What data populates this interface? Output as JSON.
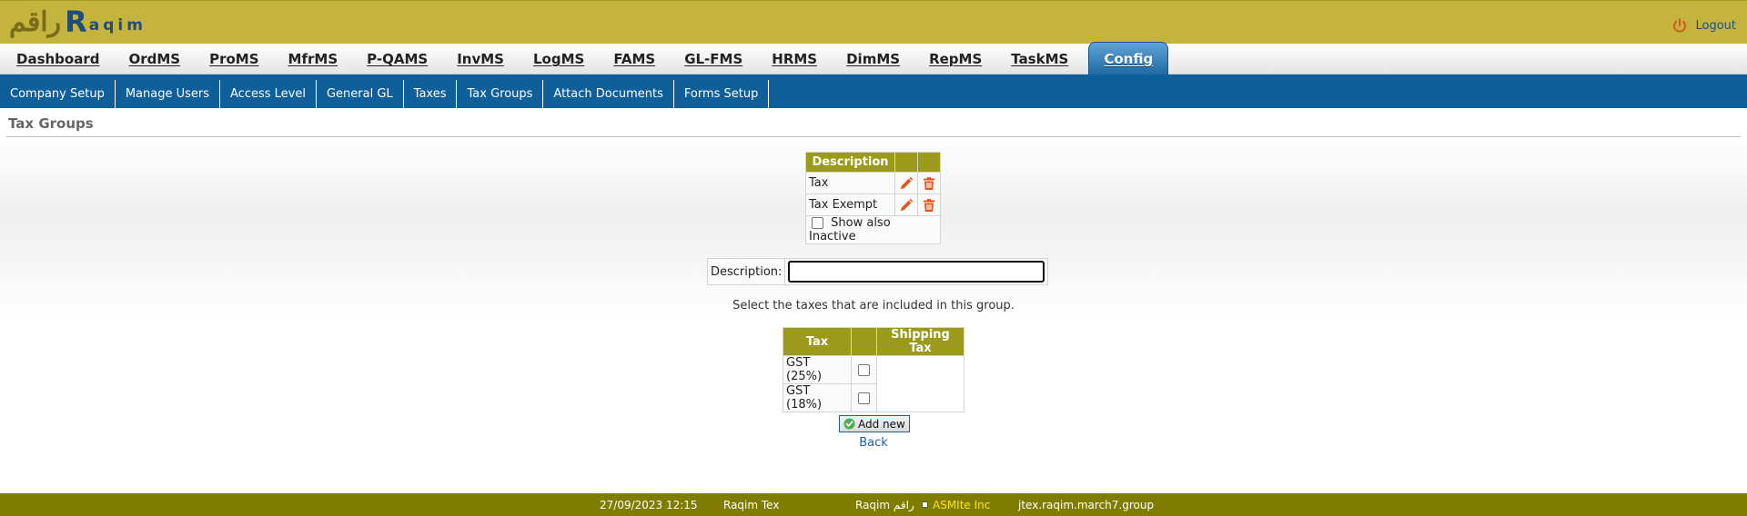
{
  "header": {
    "logo_arabic": "راقم",
    "logo_mark": "R",
    "logo_text": "aqim",
    "logout_label": "Logout"
  },
  "main_nav": {
    "items": [
      {
        "label": "Dashboard"
      },
      {
        "label": "OrdMS"
      },
      {
        "label": "ProMS"
      },
      {
        "label": "MfrMS"
      },
      {
        "label": "P-QAMS"
      },
      {
        "label": "InvMS"
      },
      {
        "label": "LogMS"
      },
      {
        "label": "FAMS"
      },
      {
        "label": "GL-FMS"
      },
      {
        "label": "HRMS"
      },
      {
        "label": "DimMS"
      },
      {
        "label": "RepMS"
      },
      {
        "label": "TaskMS"
      },
      {
        "label": "Config",
        "active": true
      }
    ]
  },
  "sub_nav": {
    "items": [
      {
        "label": "Company Setup"
      },
      {
        "label": "Manage Users"
      },
      {
        "label": "Access Level"
      },
      {
        "label": "General GL"
      },
      {
        "label": "Taxes"
      },
      {
        "label": "Tax Groups"
      },
      {
        "label": "Attach Documents"
      },
      {
        "label": "Forms Setup"
      }
    ]
  },
  "page": {
    "title": "Tax Groups"
  },
  "groups_table": {
    "header_description": "Description",
    "rows": [
      {
        "description": "Tax"
      },
      {
        "description": "Tax Exempt"
      }
    ],
    "show_inactive_label": "Show also Inactive"
  },
  "form": {
    "description_label": "Description:",
    "description_value": "",
    "hint": "Select the taxes that are included in this group.",
    "tax_header": "Tax",
    "shipping_header": "Shipping Tax",
    "taxes": [
      {
        "name": "GST (25%)"
      },
      {
        "name": "GST (18%)"
      }
    ],
    "add_button": "Add new",
    "back_link": "Back"
  },
  "footer": {
    "datetime": "27/09/2023 12:15",
    "app_name": "Raqim Tex",
    "brand": "Raqim راقم",
    "company": "ASMIte Inc",
    "host": "jtex.raqim.march7.group"
  },
  "colors": {
    "header_bg": "#c4b43d",
    "nav_blue": "#0e5f9a",
    "table_header": "#9c9a1c",
    "footer_bg": "#807c00",
    "icon_orange": "#e5541b"
  }
}
